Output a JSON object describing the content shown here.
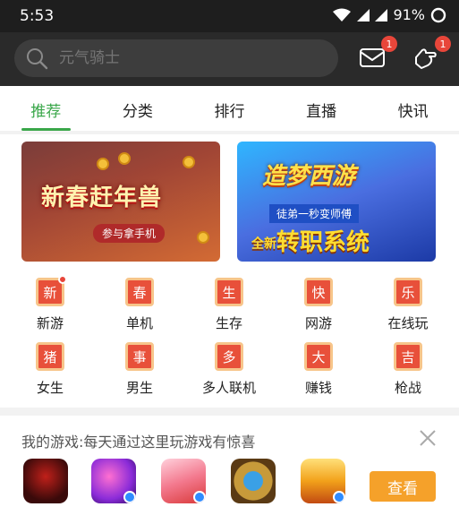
{
  "status_bar": {
    "time": "5:53",
    "battery": "91%"
  },
  "search": {
    "placeholder": "元气骑士"
  },
  "header_badges": {
    "messages": "1",
    "gifts": "1"
  },
  "tabs": [
    {
      "label": "推荐",
      "active": true
    },
    {
      "label": "分类"
    },
    {
      "label": "排行"
    },
    {
      "label": "直播"
    },
    {
      "label": "快讯"
    }
  ],
  "banners": [
    {
      "title": "新春赶年兽",
      "button": "参与拿手机"
    },
    {
      "title": "造梦西游",
      "subtitle": "徒弟一秒变师傅",
      "headline": "转职系统",
      "tag": "全新"
    }
  ],
  "categories": [
    {
      "icon_char": "新",
      "label": "新游"
    },
    {
      "icon_char": "春",
      "label": "单机"
    },
    {
      "icon_char": "生",
      "label": "生存"
    },
    {
      "icon_char": "快",
      "label": "网游"
    },
    {
      "icon_char": "乐",
      "label": "在线玩"
    },
    {
      "icon_char": "猪",
      "label": "女生"
    },
    {
      "icon_char": "事",
      "label": "男生"
    },
    {
      "icon_char": "多",
      "label": "多人联机"
    },
    {
      "icon_char": "大",
      "label": "赚钱"
    },
    {
      "icon_char": "吉",
      "label": "枪战"
    }
  ],
  "my_games": {
    "title": "我的游戏:每天通过这里玩游戏有惊喜",
    "view_button": "查看",
    "games": [
      {
        "icon": "game-icon-sha"
      },
      {
        "icon": "game-icon-music"
      },
      {
        "icon": "game-icon-anime"
      },
      {
        "icon": "game-icon-hearthstone"
      },
      {
        "icon": "game-icon-naruto"
      }
    ]
  },
  "colors": {
    "accent": "#3aa74a",
    "badge": "#e8463a",
    "button": "#f5a12a"
  }
}
